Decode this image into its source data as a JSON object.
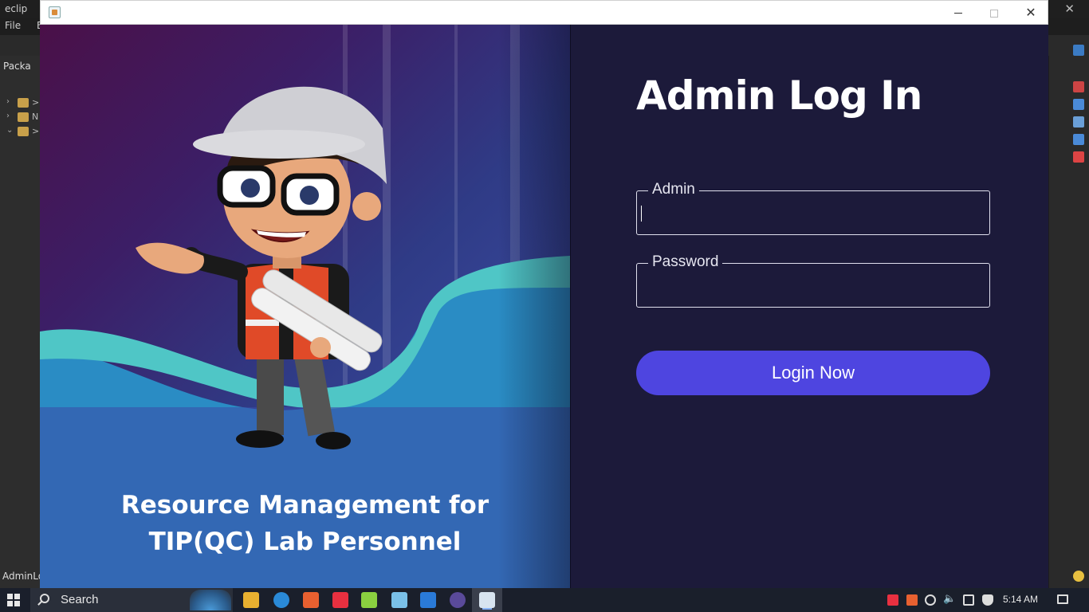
{
  "ide": {
    "app_title": "eclip",
    "menu": [
      "File",
      "E"
    ],
    "left_tab": "Packa",
    "tree_labels": [
      ">",
      "N",
      ">",
      "",
      "",
      ""
    ],
    "status": "AdminLo"
  },
  "window": {
    "title": ""
  },
  "hero": {
    "title_line1": "Resource Management for",
    "title_line2": "TIP(QC) Lab Personnel"
  },
  "form": {
    "title": "Admin Log In",
    "admin_label": "Admin",
    "admin_value": "",
    "password_label": "Password",
    "password_value": "",
    "login_button": "Login Now"
  },
  "taskbar": {
    "search_label": "Search",
    "time": "5:14 AM",
    "apps": [
      "file-explorer",
      "edge",
      "xampp",
      "anydesk",
      "notepad-plus",
      "notepad",
      "vscode",
      "eclipse",
      "java"
    ]
  },
  "colors": {
    "panel_bg": "#1c1a3a",
    "button": "#4e45e0",
    "wave_teal": "#4fc6c6",
    "wave_blue": "#2a8cc4"
  }
}
